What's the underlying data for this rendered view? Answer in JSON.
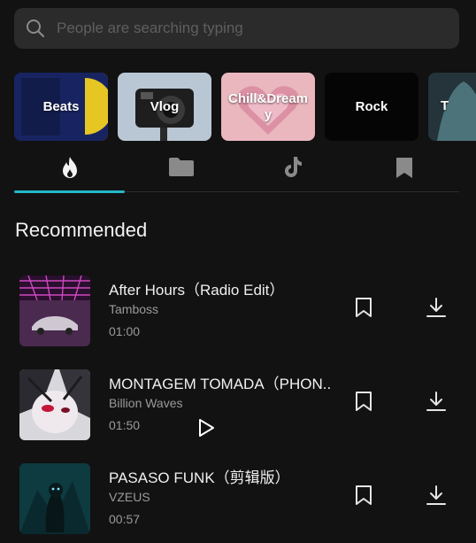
{
  "search": {
    "placeholder": "People are searching typing"
  },
  "categories": [
    {
      "label": "Beats"
    },
    {
      "label": "Vlog"
    },
    {
      "label": "Chill&Dreamy"
    },
    {
      "label": "Rock"
    },
    {
      "label": "T"
    }
  ],
  "tabs": [
    {
      "icon": "fire-icon",
      "active": true
    },
    {
      "icon": "folder-icon"
    },
    {
      "icon": "tiktok-icon"
    },
    {
      "icon": "bookmark-icon"
    }
  ],
  "section_title": "Recommended",
  "tracks": [
    {
      "title": "After Hours（Radio Edit）",
      "artist": "Tamboss",
      "duration": "01:00"
    },
    {
      "title": "MONTAGEM TOMADA（PHON..",
      "artist": "Billion Waves",
      "duration": "01:50"
    },
    {
      "title": "PASASO FUNK（剪辑版）",
      "artist": "VZEUS",
      "duration": "00:57"
    }
  ],
  "colors": {
    "accent": "#22b8c8",
    "background": "#121212",
    "search_bg": "#2b2b2b"
  }
}
